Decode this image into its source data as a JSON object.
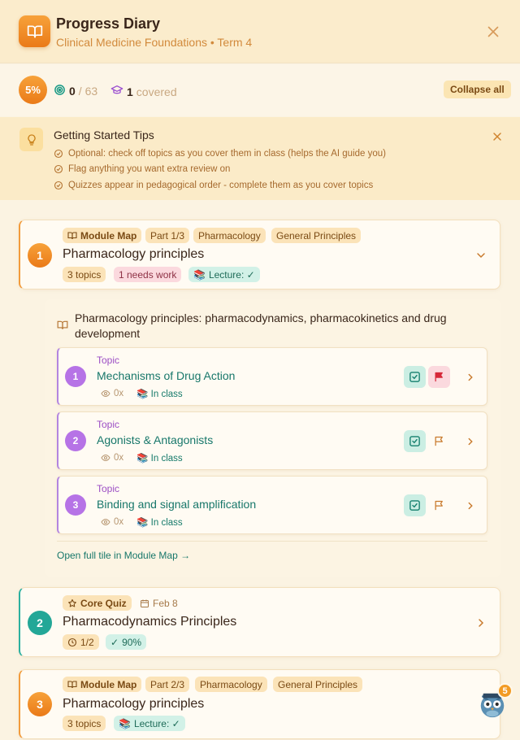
{
  "header": {
    "title": "Progress Diary",
    "subtitle": "Clinical Medicine Foundations • Term 4"
  },
  "progress": {
    "percent": "5%",
    "done": "0",
    "total": "/ 63",
    "covered_count": "1",
    "covered_label": "covered",
    "collapse_label": "Collapse all"
  },
  "tips": {
    "title": "Getting Started Tips",
    "items": [
      "Optional: check off topics as you cover them in class (helps the AI guide you)",
      "Flag anything you want extra review on",
      "Quizzes appear in pedagogical order - complete them as you cover topics"
    ]
  },
  "modules": [
    {
      "number": "1",
      "tag": "Module Map",
      "part": "Part 1/3",
      "subject": "Pharmacology",
      "category": "General Principles",
      "title": "Pharmacology principles",
      "topics_chip": "3 topics",
      "needs_work": "1 needs work",
      "lecture": "Lecture: ✓",
      "expanded": {
        "heading": "Pharmacology principles: pharmacodynamics, pharmacokinetics and drug development",
        "topic_kind": "Topic",
        "topics": [
          {
            "number": "1",
            "name": "Mechanisms of Drug Action",
            "views": "0x",
            "status": "In class",
            "flagged": true
          },
          {
            "number": "2",
            "name": "Agonists & Antagonists",
            "views": "0x",
            "status": "In class",
            "flagged": false
          },
          {
            "number": "3",
            "name": "Binding and signal amplification",
            "views": "0x",
            "status": "In class",
            "flagged": false
          }
        ],
        "open_link": "Open full tile in Module Map →"
      }
    },
    {
      "number": "2",
      "tag": "Core Quiz",
      "date": "Feb 8",
      "title": "Pharmacodynamics Principles",
      "attempts": "1/2",
      "score": "90%"
    },
    {
      "number": "3",
      "tag": "Module Map",
      "part": "Part 2/3",
      "subject": "Pharmacology",
      "category": "General Principles",
      "title": "Pharmacology principles",
      "topics_chip": "3 topics",
      "lecture": "Lecture: ✓"
    }
  ],
  "assistant": {
    "badge_count": "5",
    "icon": "owl-icon"
  },
  "colors": {
    "accent_orange": "#ea7a18",
    "teal": "#23a797",
    "purple": "#b673e6",
    "flag_red": "#d62839"
  }
}
